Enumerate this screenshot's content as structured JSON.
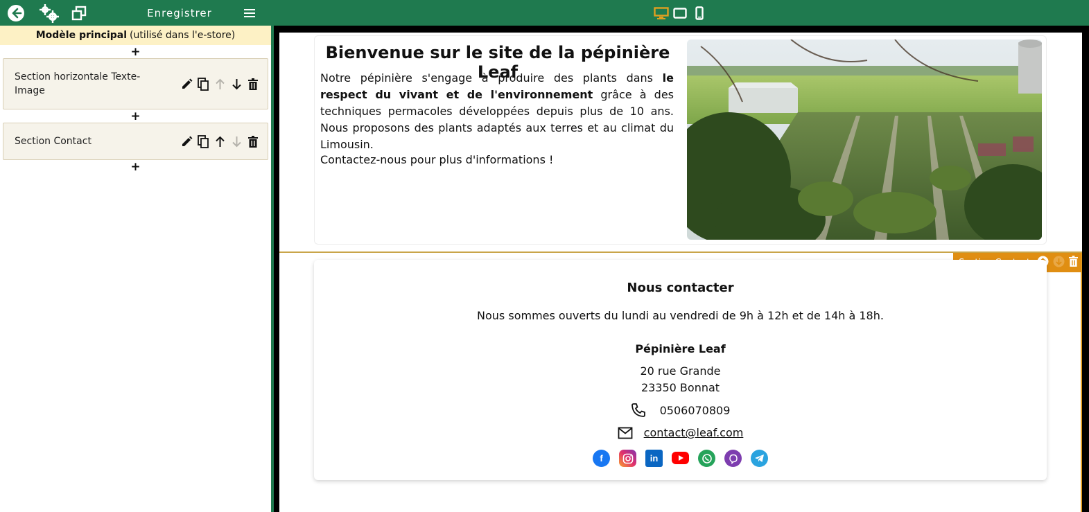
{
  "toolbar": {
    "save_label": "Enregistrer",
    "accent": "#1f7a4f",
    "active_device_color": "#e0a020"
  },
  "sidebar": {
    "model_bold": "Modèle principal",
    "model_note": "(utilisé dans l'e-store)",
    "add_symbol": "+",
    "sections": [
      {
        "label": "Section horizontale Texte-Image"
      },
      {
        "label": "Section Contact"
      }
    ]
  },
  "preview": {
    "hero": {
      "title": "Bienvenue sur le site de la pépinière Leaf",
      "p1_a": "Notre pépinière s'engage à produire des plants dans ",
      "p1_b": "le respect du vivant et de l'environnement",
      "p1_c": " grâce à des techniques permacoles développées depuis plus de 10 ans. Nous proposons des plants adaptés aux terres et au climat du Limousin.",
      "p2": "Contactez-nous pour plus d'informations !"
    },
    "contact": {
      "badge": "Section Contact",
      "badge_color": "#e08e12",
      "title": "Nous contacter",
      "hours": "Nous sommes ouverts du lundi au vendredi de 9h à 12h et de 14h à 18h.",
      "name": "Pépinière Leaf",
      "street": "20 rue Grande",
      "city": "23350 Bonnat",
      "phone": "0506070809",
      "email": "contact@leaf.com",
      "social": [
        "facebook",
        "instagram",
        "linkedin",
        "youtube",
        "whatsapp",
        "viber",
        "telegram"
      ]
    }
  }
}
